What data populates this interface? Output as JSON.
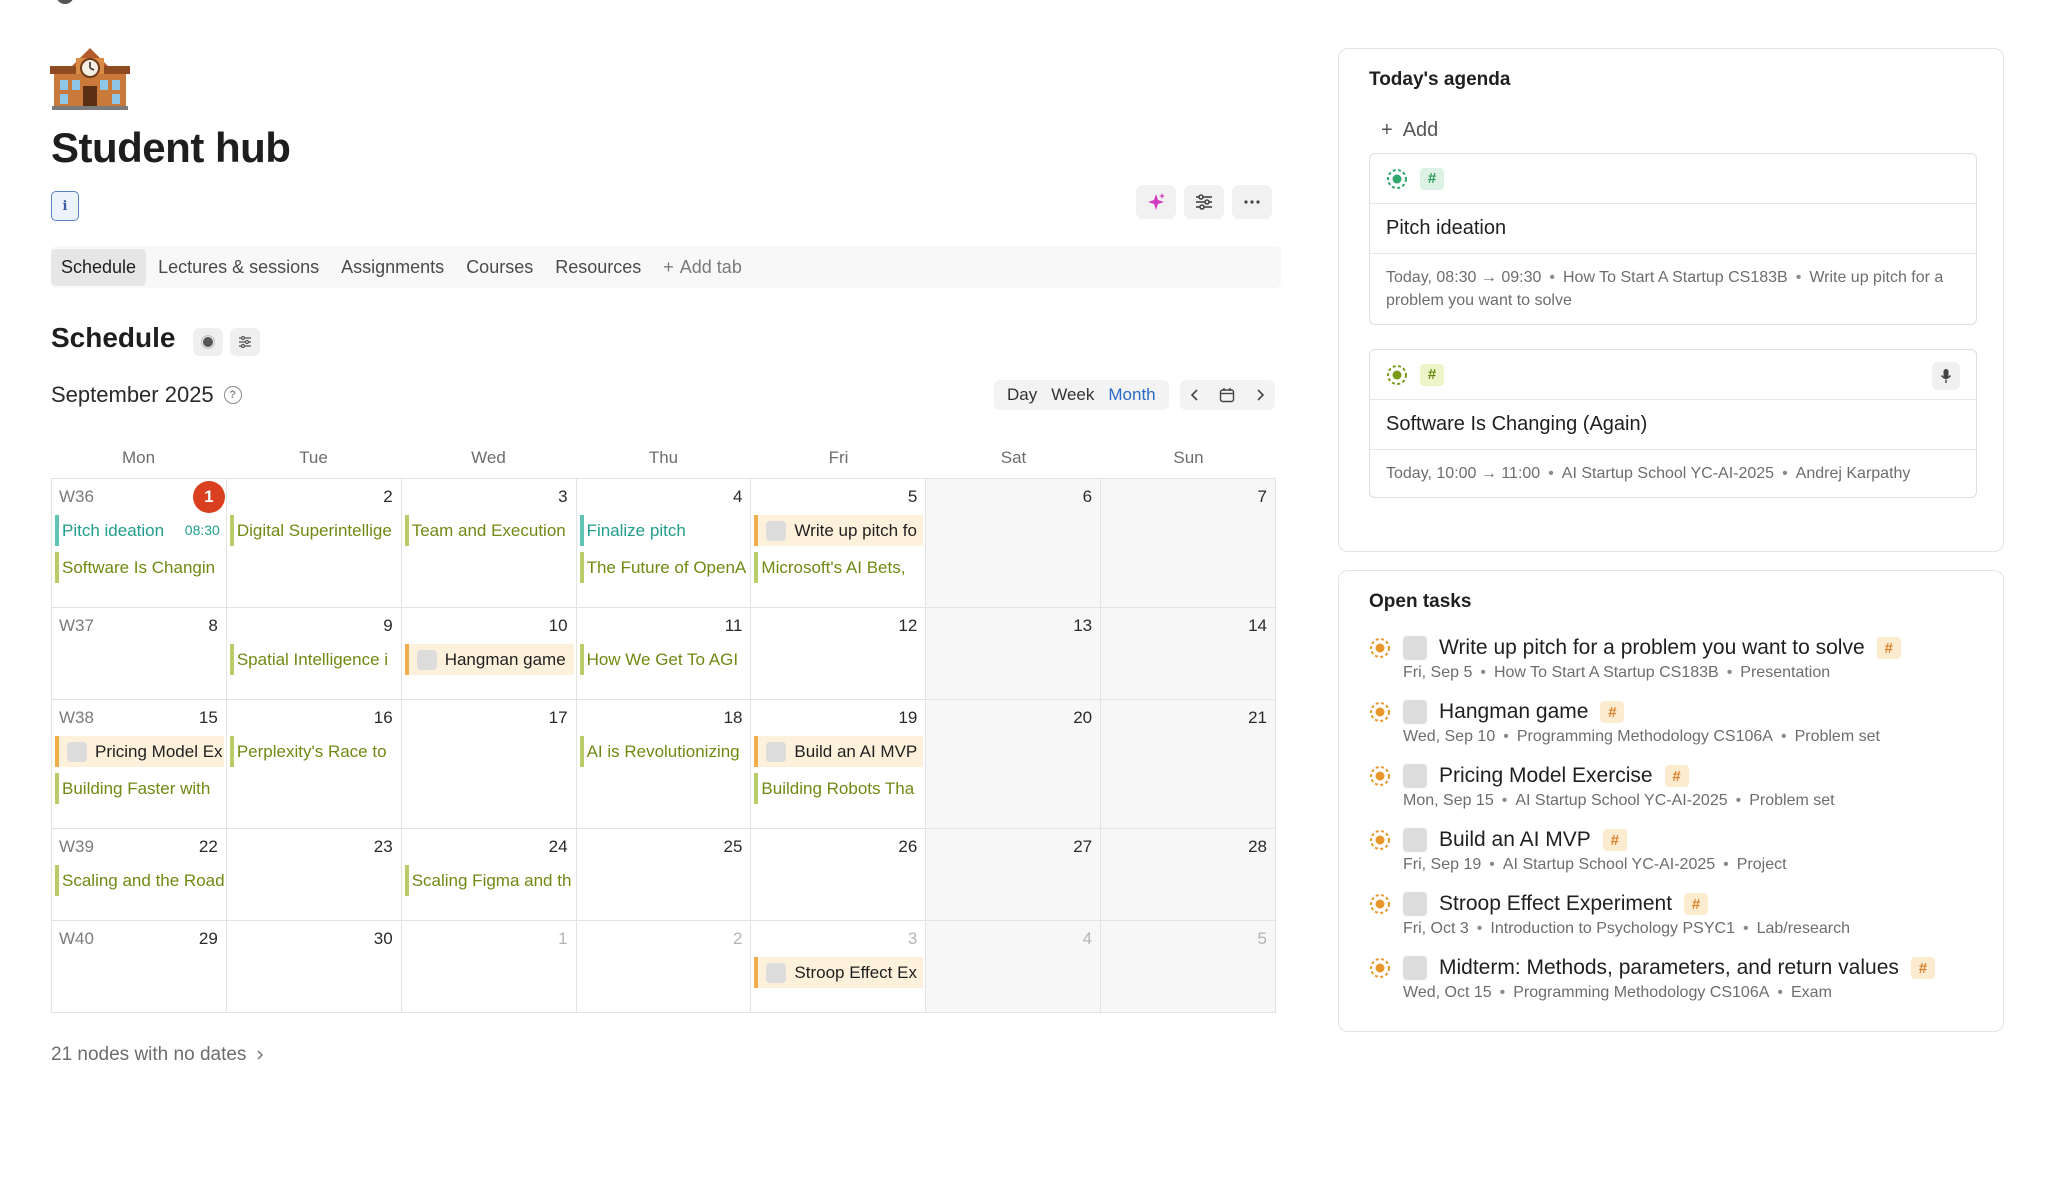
{
  "page": {
    "title": "Student hub",
    "info_label": "i"
  },
  "tabs": [
    {
      "label": "Schedule"
    },
    {
      "label": "Lectures & sessions"
    },
    {
      "label": "Assignments"
    },
    {
      "label": "Courses"
    },
    {
      "label": "Resources"
    }
  ],
  "add_tab_label": "Add tab",
  "schedule": {
    "title": "Schedule",
    "month_label": "September 2025",
    "views": [
      "Day",
      "Week",
      "Month"
    ],
    "active_view": "Month",
    "weekdays": [
      "Mon",
      "Tue",
      "Wed",
      "Thu",
      "Fri",
      "Sat",
      "Sun"
    ],
    "weeks": [
      {
        "label": "W36",
        "days": [
          "1",
          "2",
          "3",
          "4",
          "5",
          "6",
          "7"
        ]
      },
      {
        "label": "W37",
        "days": [
          "8",
          "9",
          "10",
          "11",
          "12",
          "13",
          "14"
        ]
      },
      {
        "label": "W38",
        "days": [
          "15",
          "16",
          "17",
          "18",
          "19",
          "20",
          "21"
        ]
      },
      {
        "label": "W39",
        "days": [
          "22",
          "23",
          "24",
          "25",
          "26",
          "27",
          "28"
        ]
      },
      {
        "label": "W40",
        "days": [
          "29",
          "30",
          "1",
          "2",
          "3",
          "4",
          "5"
        ]
      }
    ],
    "events": {
      "w36_mon_1": "Pitch ideation",
      "w36_mon_1_time": "08:30",
      "w36_mon_2": "Software Is Changin",
      "w36_tue_1": "Digital Superintellige",
      "w36_wed_1": "Team and Execution",
      "w36_thu_1": "Finalize pitch",
      "w36_thu_2": "The Future of OpenA",
      "w36_fri_1": "Write up pitch fo",
      "w36_fri_2": "Microsoft's AI Bets,",
      "w37_tue_1": "Spatial Intelligence i",
      "w37_wed_1": "Hangman game",
      "w37_thu_1": "How We Get To AGI",
      "w38_mon_1": "Pricing Model Ex",
      "w38_mon_2": "Building Faster with",
      "w38_tue_1": "Perplexity's Race to",
      "w38_thu_1": "AI is Revolutionizing",
      "w38_fri_1": "Build an AI MVP",
      "w38_fri_2": "Building Robots Tha",
      "w39_mon_1": "Scaling and the Road",
      "w39_wed_1": "Scaling Figma and th",
      "w40_fri_1": "Stroop Effect Ex"
    },
    "no_dates_label": "21 nodes with no dates"
  },
  "agenda": {
    "title": "Today's agenda",
    "add_label": "Add",
    "items": [
      {
        "title": "Pitch ideation",
        "time": "Today, 08:30 → 09:30",
        "course": "How To Start A Startup CS183B",
        "extra": "Write up pitch for a problem you want to solve"
      },
      {
        "title": "Software Is Changing (Again)",
        "time": "Today, 10:00 → 11:00",
        "course": "AI Startup School YC-AI-2025",
        "extra": "Andrej Karpathy"
      }
    ]
  },
  "open_tasks": {
    "title": "Open tasks",
    "items": [
      {
        "title": "Write up pitch for a problem you want to solve",
        "date": "Fri, Sep 5",
        "course": "How To Start A Startup CS183B",
        "type": "Presentation"
      },
      {
        "title": "Hangman game",
        "date": "Wed, Sep 10",
        "course": "Programming Methodology CS106A",
        "type": "Problem set"
      },
      {
        "title": "Pricing Model Exercise",
        "date": "Mon, Sep 15",
        "course": "AI Startup School YC-AI-2025",
        "type": "Problem set"
      },
      {
        "title": "Build an AI MVP",
        "date": "Fri, Sep 19",
        "course": "AI Startup School YC-AI-2025",
        "type": "Project"
      },
      {
        "title": "Stroop Effect Experiment",
        "date": "Fri, Oct 3",
        "course": "Introduction to Psychology PSYC1",
        "type": "Lab/research"
      },
      {
        "title": "Midterm: Methods, parameters, and return values",
        "date": "Wed, Oct 15",
        "course": "Programming Methodology CS106A",
        "type": "Exam"
      }
    ]
  },
  "tag_symbol": "#",
  "colors": {
    "accent_blue": "#2a6bc7",
    "today_red": "#d9401f",
    "event_green": "#6e8a12",
    "event_teal": "#1f9e8c",
    "task_orange": "#f1ad4b"
  }
}
